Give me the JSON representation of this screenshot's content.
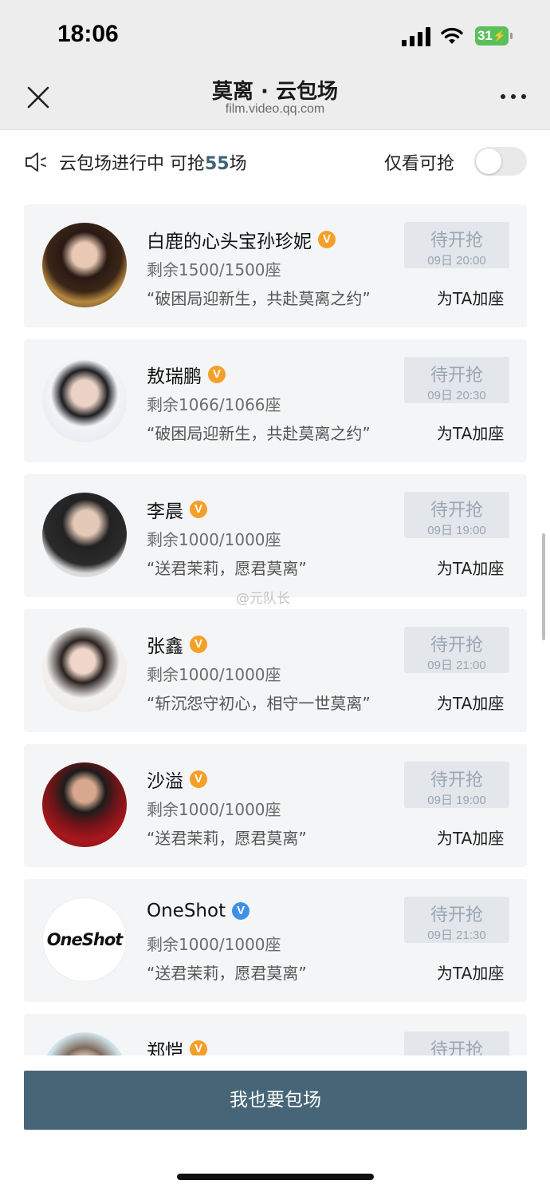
{
  "status_bar": {
    "time": "18:06",
    "battery": "31"
  },
  "nav": {
    "title": "莫离 · 云包场",
    "subtitle": "film.video.qq.com"
  },
  "notice": {
    "text_prefix": "云包场进行中 可抢",
    "count": "55",
    "text_suffix": "场",
    "filter_label": "仅看可抢"
  },
  "cards": [
    {
      "name": "白鹿的心头宝孙珍妮",
      "badge": "V",
      "badge_color": "#f4a028",
      "seats": "剩余1500/1500座",
      "slogan": "“破困局迎新生，共赴莫离之约”",
      "grab_label": "待开抢",
      "grab_time": "09日 20:00",
      "add_label": "为TA加座"
    },
    {
      "name": "敖瑞鹏",
      "badge": "V",
      "badge_color": "#f4a028",
      "seats": "剩余1066/1066座",
      "slogan": "“破困局迎新生，共赴莫离之约”",
      "grab_label": "待开抢",
      "grab_time": "09日 20:30",
      "add_label": "为TA加座"
    },
    {
      "name": "李晨",
      "badge": "V",
      "badge_color": "#f4a028",
      "seats": "剩余1000/1000座",
      "slogan": "“送君茉莉，愿君莫离”",
      "grab_label": "待开抢",
      "grab_time": "09日 19:00",
      "add_label": "为TA加座"
    },
    {
      "name": "张鑫",
      "badge": "V",
      "badge_color": "#f4a028",
      "seats": "剩余1000/1000座",
      "slogan": "“斩沉怨守初心，相守一世莫离”",
      "grab_label": "待开抢",
      "grab_time": "09日 21:00",
      "add_label": "为TA加座"
    },
    {
      "name": "沙溢",
      "badge": "V",
      "badge_color": "#f4a028",
      "seats": "剩余1000/1000座",
      "slogan": "“送君茉莉，愿君莫离”",
      "grab_label": "待开抢",
      "grab_time": "09日 19:00",
      "add_label": "为TA加座"
    },
    {
      "name": "OneShot",
      "badge": "V",
      "badge_color": "#3d91e8",
      "logo_text": "OneShot",
      "seats": "剩余1000/1000座",
      "slogan": "“送君茉莉，愿君莫离”",
      "grab_label": "待开抢",
      "grab_time": "09日 21:30",
      "add_label": "为TA加座"
    },
    {
      "name": "郑恺",
      "badge": "V",
      "badge_color": "#f4a028",
      "grab_label": "待开抢"
    }
  ],
  "watermark": "@元队长",
  "bottom_button": "我也要包场"
}
